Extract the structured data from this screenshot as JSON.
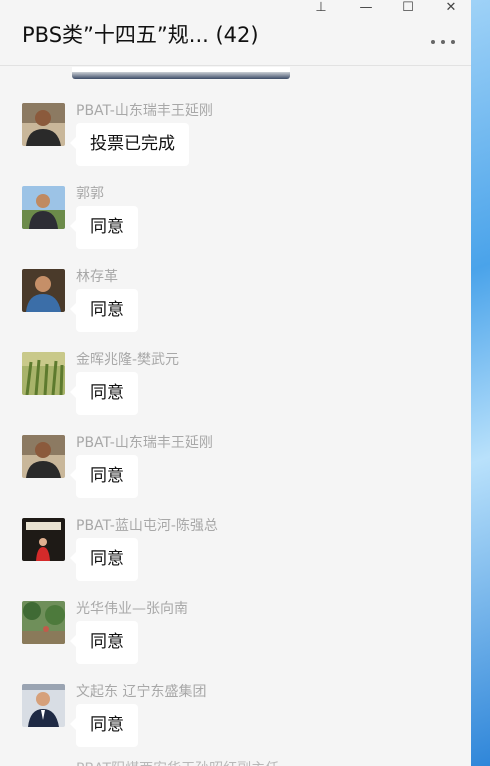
{
  "window": {
    "title": "PBS类”十四五”规... (42)",
    "controls": {
      "pin": "⊥",
      "minimize": "—",
      "maximize": "☐",
      "close": "✕"
    }
  },
  "messages": [
    {
      "sender": "PBAT-山东瑞丰王延刚",
      "text": "投票已完成",
      "avatar": "avatar-man-dark-shirt"
    },
    {
      "sender": "郭郭",
      "text": "同意",
      "avatar": "avatar-man-outdoors"
    },
    {
      "sender": "林存革",
      "text": "同意",
      "avatar": "avatar-man-blue-shirt"
    },
    {
      "sender": "金晖兆隆-樊武元",
      "text": "同意",
      "avatar": "avatar-cornfield"
    },
    {
      "sender": "PBAT-山东瑞丰王延刚",
      "text": "同意",
      "avatar": "avatar-man-dark-shirt"
    },
    {
      "sender": "PBAT-蓝山屯河-陈强总",
      "text": "同意",
      "avatar": "avatar-child-red"
    },
    {
      "sender": "光华伟业—张向南",
      "text": "同意",
      "avatar": "avatar-garden"
    },
    {
      "sender": "文起东 辽宁东盛集团",
      "text": "同意",
      "avatar": "avatar-man-suit"
    }
  ],
  "cutoff_sender": "PBAT阳煤西安华玉孙昭红副主任"
}
